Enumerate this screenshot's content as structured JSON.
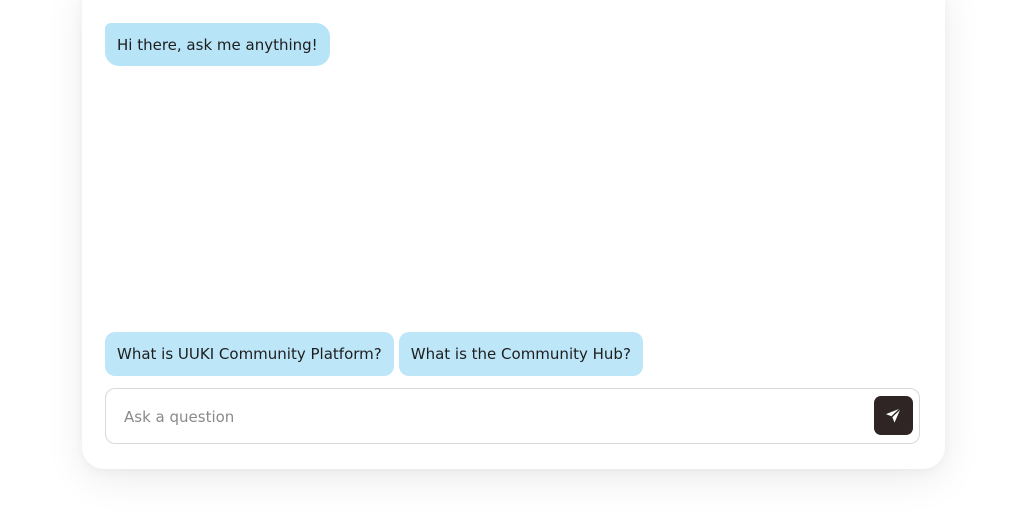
{
  "chat": {
    "greeting": "Hi there, ask me anything!"
  },
  "suggestions": [
    {
      "label": "What is UUKI Community Platform?"
    },
    {
      "label": "What is the Community Hub?"
    }
  ],
  "input": {
    "placeholder": "Ask a question",
    "value": ""
  },
  "send": {
    "icon": "send-icon"
  },
  "colors": {
    "bubble": "#b7e4f7",
    "chip": "#bde7f8",
    "send_button": "#2f2525"
  }
}
